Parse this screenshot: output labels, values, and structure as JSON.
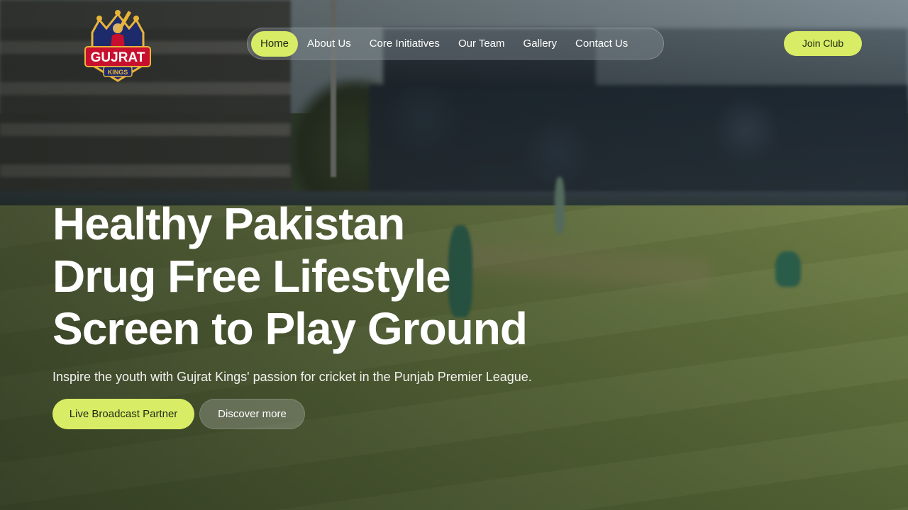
{
  "brand": {
    "logo_alt": "Gujrat Kings",
    "logo_line1": "GUJRAT",
    "logo_line2": "KINGS"
  },
  "nav": {
    "items": [
      {
        "label": "Home",
        "active": true
      },
      {
        "label": "About Us",
        "active": false
      },
      {
        "label": "Core Initiatives",
        "active": false
      },
      {
        "label": "Our Team",
        "active": false
      },
      {
        "label": "Gallery",
        "active": false
      },
      {
        "label": "Contact Us",
        "active": false
      }
    ]
  },
  "header": {
    "join_label": "Join Club"
  },
  "hero": {
    "title_lines": [
      "Healthy Pakistan",
      "Drug Free Lifestyle",
      "Screen to Play Ground"
    ],
    "subtitle": "Inspire the youth with Gujrat Kings' passion for cricket in the Punjab Premier League.",
    "primary_button": "Live Broadcast Partner",
    "secondary_button": "Discover more"
  },
  "colors": {
    "accent": "#d9ec66",
    "accent_text": "#1f2a14",
    "logo_red": "#c8102e",
    "logo_navy": "#1d2a6b",
    "logo_gold": "#e8b43a"
  }
}
